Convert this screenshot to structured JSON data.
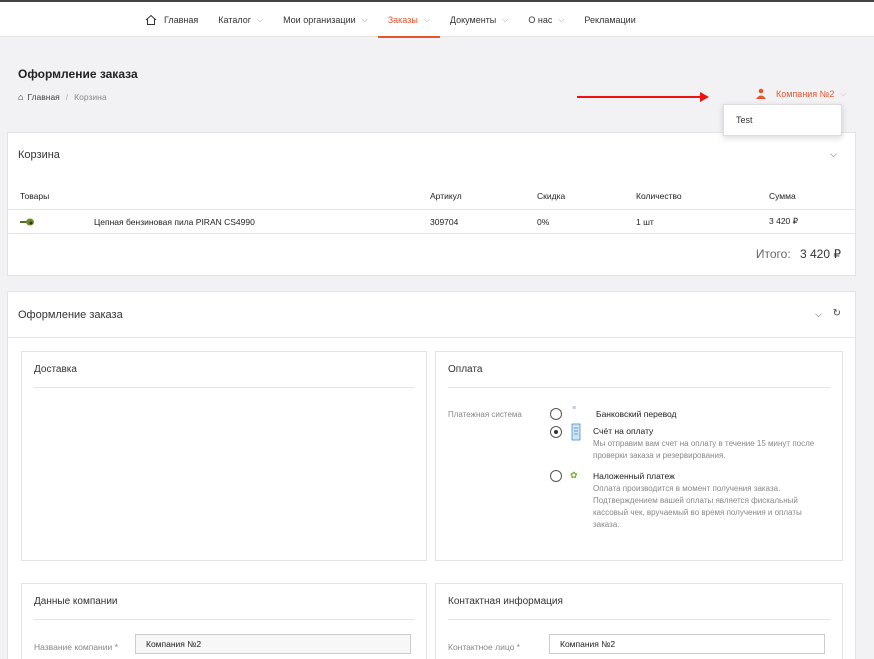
{
  "nav": {
    "home": "Главная",
    "catalog": "Каталог",
    "orgs": "Мои организации",
    "orders": "Заказы",
    "docs": "Документы",
    "about": "О нас",
    "ads": "Рекламации"
  },
  "page": {
    "title": "Оформление заказа",
    "breadcrumb": [
      "Главная",
      "Корзина"
    ]
  },
  "company_selector": {
    "value": "Компания №2",
    "options": [
      "Test"
    ]
  },
  "cart": {
    "title": "Корзина",
    "columns": [
      "Товары",
      "Артикул",
      "Скидка",
      "Количество",
      "Сумма"
    ],
    "rows": [
      {
        "name": "Цепная бензиновая пила PIRAN CS4990",
        "sku": "309704",
        "discount": "0%",
        "qty": "1 шт",
        "sum": "3 420 ₽"
      }
    ],
    "total_label": "Итого:",
    "total_value": "3 420 ₽"
  },
  "order": {
    "title": "Оформление заказа",
    "delivery_title": "Доставка",
    "payment_title": "Оплата",
    "payment_label": "Платежная система",
    "methods": [
      {
        "name": "Банковский перевод",
        "desc": "",
        "selected": false
      },
      {
        "name": "Счёт на оплату",
        "desc": "Мы отправим вам счет на оплату в течение 15 минут после проверки заказа и резервирования.",
        "selected": true
      },
      {
        "name": "Наложенный платеж",
        "desc": "Оплата производится в момент получения заказа. Подтверждением вашей оплаты является фискальный кассовый чек, вручаемый во время получения и оплаты заказа.",
        "selected": false
      }
    ],
    "company_data_title": "Данные компании",
    "company_name_label": "Название компании *",
    "company_name_value": "Компания №2",
    "contact_title": "Контактная информация",
    "contact_person_label": "Контактное лицо *",
    "contact_person_value": "Компания №2"
  },
  "colors": {
    "accent": "#e8542c",
    "arrow": "#e11111"
  }
}
